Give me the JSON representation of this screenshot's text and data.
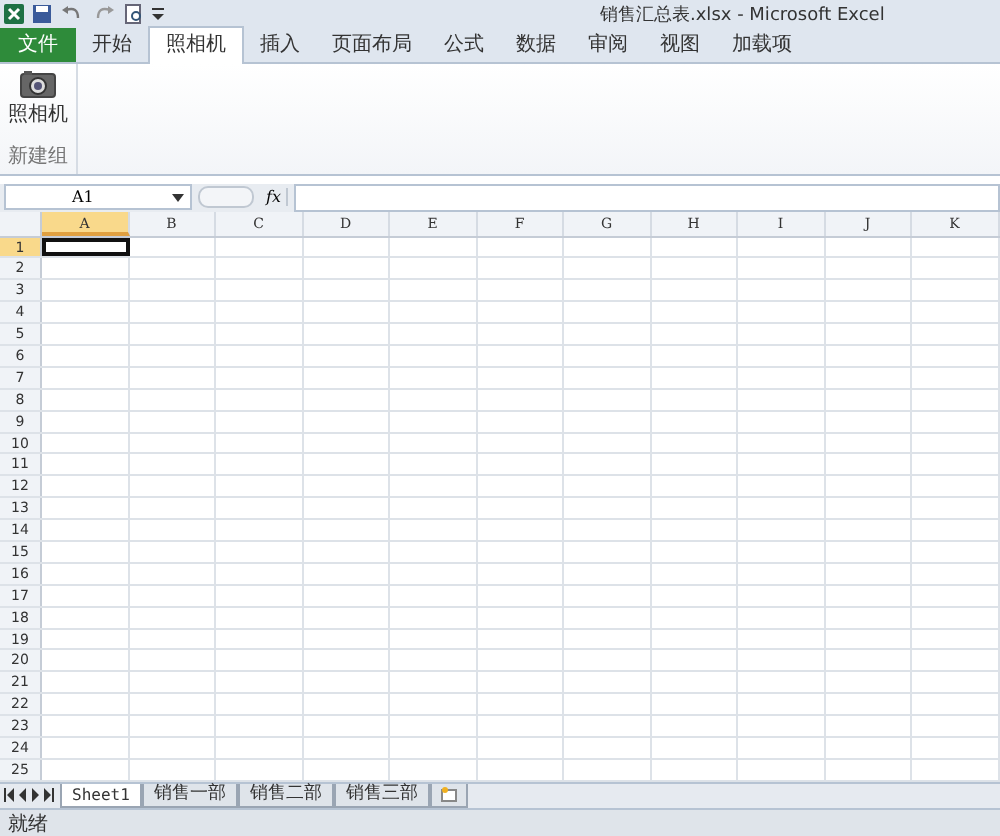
{
  "window": {
    "title": "销售汇总表.xlsx - Microsoft Excel"
  },
  "tabs": [
    {
      "label": "文件",
      "kind": "file",
      "selected": false
    },
    {
      "label": "开始",
      "kind": "tab",
      "selected": false
    },
    {
      "label": "照相机",
      "kind": "tab",
      "selected": true
    },
    {
      "label": "插入",
      "kind": "tab",
      "selected": false
    },
    {
      "label": "页面布局",
      "kind": "tab",
      "selected": false
    },
    {
      "label": "公式",
      "kind": "tab",
      "selected": false
    },
    {
      "label": "数据",
      "kind": "tab",
      "selected": false
    },
    {
      "label": "审阅",
      "kind": "tab",
      "selected": false
    },
    {
      "label": "视图",
      "kind": "tab",
      "selected": false
    },
    {
      "label": "加载项",
      "kind": "tab",
      "selected": false
    }
  ],
  "ribbon": {
    "button": "照相机",
    "group_label": "新建组"
  },
  "formula_bar": {
    "name_box": "A1",
    "function_label": "fx"
  },
  "columns": [
    {
      "label": "A",
      "selected": true
    },
    {
      "label": "B",
      "selected": false
    },
    {
      "label": "C",
      "selected": false
    },
    {
      "label": "D",
      "selected": false
    },
    {
      "label": "E",
      "selected": false
    },
    {
      "label": "F",
      "selected": false
    },
    {
      "label": "G",
      "selected": false
    },
    {
      "label": "H",
      "selected": false
    },
    {
      "label": "I",
      "selected": false
    },
    {
      "label": "J",
      "selected": false
    },
    {
      "label": "K",
      "selected": false
    }
  ],
  "rows": [
    {
      "label": "1",
      "selected": true
    },
    {
      "label": "2",
      "selected": false
    },
    {
      "label": "3",
      "selected": false
    },
    {
      "label": "4",
      "selected": false
    },
    {
      "label": "5",
      "selected": false
    },
    {
      "label": "6",
      "selected": false
    },
    {
      "label": "7",
      "selected": false
    },
    {
      "label": "8",
      "selected": false
    },
    {
      "label": "9",
      "selected": false
    },
    {
      "label": "10",
      "selected": false
    },
    {
      "label": "11",
      "selected": false
    },
    {
      "label": "12",
      "selected": false
    },
    {
      "label": "13",
      "selected": false
    },
    {
      "label": "14",
      "selected": false
    },
    {
      "label": "15",
      "selected": false
    },
    {
      "label": "16",
      "selected": false
    },
    {
      "label": "17",
      "selected": false
    },
    {
      "label": "18",
      "selected": false
    },
    {
      "label": "19",
      "selected": false
    },
    {
      "label": "20",
      "selected": false
    },
    {
      "label": "21",
      "selected": false
    },
    {
      "label": "22",
      "selected": false
    },
    {
      "label": "23",
      "selected": false
    },
    {
      "label": "24",
      "selected": false
    },
    {
      "label": "25",
      "selected": false
    }
  ],
  "sheet_tabs": [
    {
      "label": "Sheet1",
      "selected": true
    },
    {
      "label": "销售一部",
      "selected": false
    },
    {
      "label": "销售二部",
      "selected": false
    },
    {
      "label": "销售三部",
      "selected": false
    }
  ],
  "status_bar": {
    "text": "就绪"
  }
}
